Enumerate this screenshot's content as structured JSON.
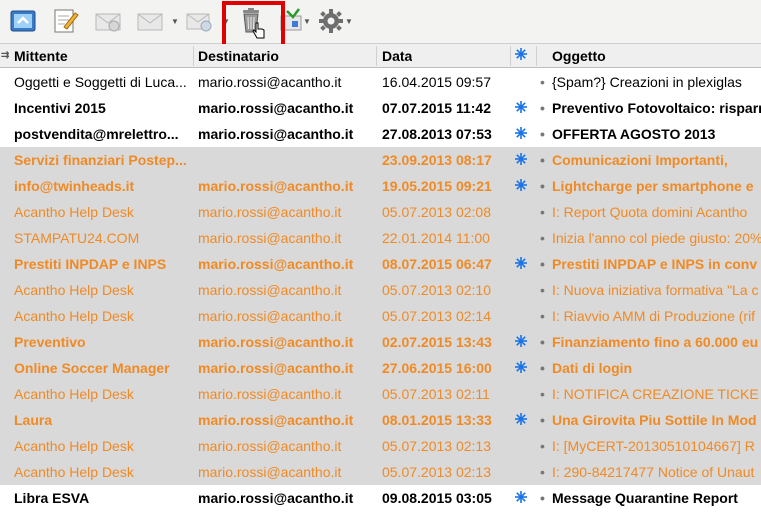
{
  "columns": {
    "sender": "Mittente",
    "recipient": "Destinatario",
    "date": "Data",
    "subject": "Oggetto"
  },
  "toolbar": {
    "buttons": [
      {
        "name": "get-mail-icon"
      },
      {
        "name": "compose-icon"
      },
      {
        "name": "reply-icon"
      },
      {
        "name": "forward-icon"
      },
      {
        "name": "send-receive-icon"
      },
      {
        "name": "trash-icon",
        "highlighted": true
      },
      {
        "name": "junk-filter-icon"
      },
      {
        "name": "settings-gear-icon"
      }
    ]
  },
  "colors": {
    "orange": "#f08a24",
    "star_blue": "#1a73e8",
    "highlight_red": "#e00000",
    "row_gray": "#d9d9d9"
  },
  "messages": [
    {
      "sender": "Oggetti e Soggetti di Luca...",
      "recipient": "mario.rossi@acantho.it",
      "date": "16.04.2015 09:57",
      "star": false,
      "subject": "{Spam?} Creazioni in plexiglas",
      "bold": false,
      "color": "black",
      "gray": false
    },
    {
      "sender": "Incentivi 2015",
      "recipient": "mario.rossi@acantho.it",
      "date": "07.07.2015 11:42",
      "star": true,
      "subject": "Preventivo Fotovoltaico: risparmia",
      "bold": true,
      "color": "black",
      "gray": false
    },
    {
      "sender": "postvendita@mrelettro...",
      "recipient": "mario.rossi@acantho.it",
      "date": "27.08.2013 07:53",
      "star": true,
      "subject": "OFFERTA AGOSTO 2013",
      "bold": true,
      "color": "black",
      "gray": false
    },
    {
      "sender": "Servizi finanziari Postep...",
      "recipient": "",
      "date": "23.09.2013 08:17",
      "star": true,
      "subject": "Comunicazioni Importanti,",
      "bold": true,
      "color": "orange",
      "gray": true
    },
    {
      "sender": "info@twinheads.it",
      "recipient": "mario.rossi@acantho.it",
      "date": "19.05.2015 09:21",
      "star": true,
      "subject": "Lightcharge per smartphone e",
      "bold": true,
      "color": "orange",
      "gray": true
    },
    {
      "sender": "Acantho Help Desk",
      "recipient": "mario.rossi@acantho.it",
      "date": "05.07.2013 02:08",
      "star": false,
      "subject": "I: Report Quota domini Acantho",
      "bold": false,
      "color": "orange",
      "gray": true
    },
    {
      "sender": "STAMPATU24.COM",
      "recipient": "mario.rossi@acantho.it",
      "date": "22.01.2014 11:00",
      "star": false,
      "subject": "Inizia l'anno col piede giusto: 20%",
      "bold": false,
      "color": "orange",
      "gray": true
    },
    {
      "sender": "Prestiti INPDAP e INPS",
      "recipient": "mario.rossi@acantho.it",
      "date": "08.07.2015 06:47",
      "star": true,
      "subject": "Prestiti INPDAP e INPS in conv",
      "bold": true,
      "color": "orange",
      "gray": true
    },
    {
      "sender": "Acantho Help Desk",
      "recipient": "mario.rossi@acantho.it",
      "date": "05.07.2013 02:10",
      "star": false,
      "subject": "I: Nuova iniziativa formativa \"La c",
      "bold": false,
      "color": "orange",
      "gray": true
    },
    {
      "sender": "Acantho Help Desk",
      "recipient": "mario.rossi@acantho.it",
      "date": "05.07.2013 02:14",
      "star": false,
      "subject": "I: Riavvio AMM di Produzione (rif",
      "bold": false,
      "color": "orange",
      "gray": true
    },
    {
      "sender": "Preventivo",
      "recipient": "mario.rossi@acantho.it",
      "date": "02.07.2015 13:43",
      "star": true,
      "subject": "Finanziamento fino a 60.000 eu",
      "bold": true,
      "color": "orange",
      "gray": true
    },
    {
      "sender": "Online Soccer Manager",
      "recipient": "mario.rossi@acantho.it",
      "date": "27.06.2015 16:00",
      "star": true,
      "subject": "Dati di login",
      "bold": true,
      "color": "orange",
      "gray": true
    },
    {
      "sender": "Acantho Help Desk",
      "recipient": "mario.rossi@acantho.it",
      "date": "05.07.2013 02:11",
      "star": false,
      "subject": "I: NOTIFICA CREAZIONE TICKE",
      "bold": false,
      "color": "orange",
      "gray": true
    },
    {
      "sender": "Laura",
      "recipient": "mario.rossi@acantho.it",
      "date": "08.01.2015 13:33",
      "star": true,
      "subject": "Una Girovita Piu Sottile In Mod",
      "bold": true,
      "color": "orange",
      "gray": true
    },
    {
      "sender": "Acantho Help Desk",
      "recipient": "mario.rossi@acantho.it",
      "date": "05.07.2013 02:13",
      "star": false,
      "subject": "I: [MyCERT-20130510104667] R",
      "bold": false,
      "color": "orange",
      "gray": true
    },
    {
      "sender": "Acantho Help Desk",
      "recipient": "mario.rossi@acantho.it",
      "date": "05.07.2013 02:13",
      "star": false,
      "subject": "I: 290-84217477 Notice of Unaut",
      "bold": false,
      "color": "orange",
      "gray": true
    },
    {
      "sender": "Libra ESVA",
      "recipient": "mario.rossi@acantho.it",
      "date": "09.08.2015 03:05",
      "star": true,
      "subject": "Message Quarantine Report",
      "bold": true,
      "color": "black",
      "gray": false
    }
  ]
}
